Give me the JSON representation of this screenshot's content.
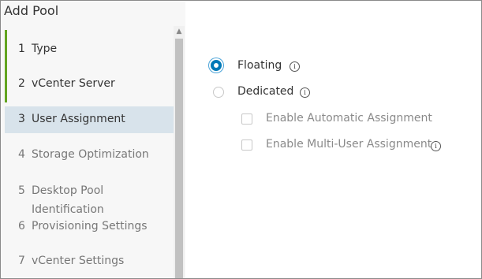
{
  "dialog": {
    "title": "Add Pool"
  },
  "wizard": {
    "steps": [
      {
        "num": "1",
        "label": "Type",
        "state": "done"
      },
      {
        "num": "2",
        "label": "vCenter Server",
        "state": "done"
      },
      {
        "num": "3",
        "label": "User Assignment",
        "state": "current"
      },
      {
        "num": "4",
        "label": "Storage Optimization",
        "state": "future"
      },
      {
        "num": "5",
        "label": "Desktop Pool Identification",
        "label_line1": "Desktop Pool",
        "label_line2": "Identification",
        "state": "future"
      },
      {
        "num": "6",
        "label": "Provisioning Settings",
        "state": "future"
      },
      {
        "num": "7",
        "label": "vCenter Settings",
        "state": "future"
      }
    ]
  },
  "user_assignment": {
    "floating": {
      "label": "Floating",
      "selected": true,
      "info_icon": "info-icon"
    },
    "dedicated": {
      "label": "Dedicated",
      "selected": false,
      "info_icon": "info-icon"
    },
    "enable_automatic": {
      "label": "Enable Automatic Assignment",
      "checked": false,
      "enabled": false
    },
    "enable_multi_user": {
      "label": "Enable Multi-User Assignment",
      "checked": false,
      "enabled": false,
      "info_icon": "info-icon"
    }
  },
  "colors": {
    "accent": "#0079b8",
    "done_bar": "#62a420",
    "current_bg": "#d8e3eb"
  }
}
